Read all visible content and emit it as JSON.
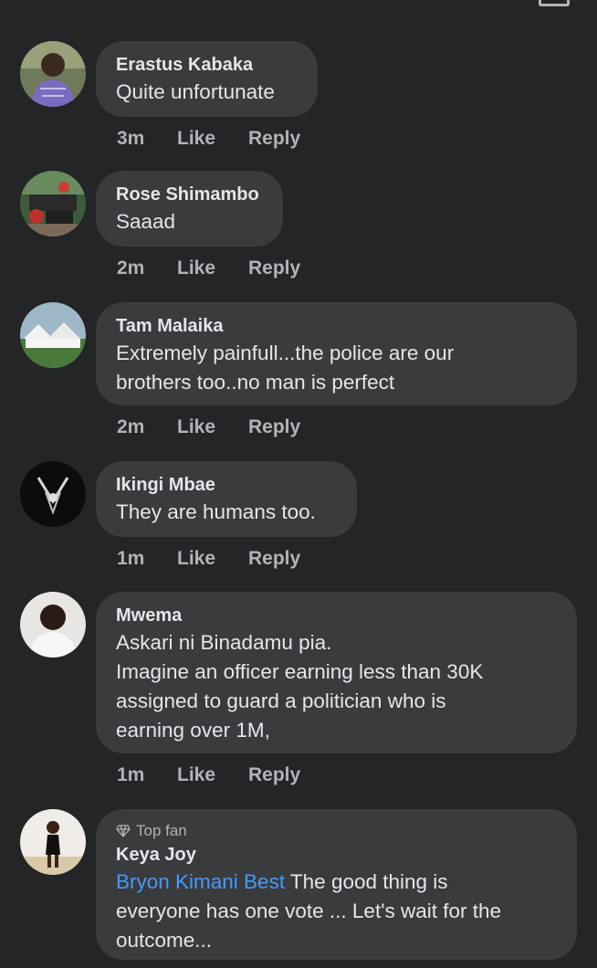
{
  "comments": [
    {
      "name": "Erastus Kabaka",
      "text": "Quite unfortunate",
      "time": "3m",
      "like": "Like",
      "reply": "Reply"
    },
    {
      "name": "Rose Shimambo",
      "text": "Saaad",
      "time": "2m",
      "like": "Like",
      "reply": "Reply"
    },
    {
      "name": "Tam Malaika",
      "text_lines": [
        "Extremely painfull...the police are our",
        "brothers too..no man is perfect"
      ],
      "time": "2m",
      "like": "Like",
      "reply": "Reply"
    },
    {
      "name": "Ikingi Mbae",
      "text": "They are humans too.",
      "time": "1m",
      "like": "Like",
      "reply": "Reply"
    },
    {
      "name": "Mwema",
      "text_lines": [
        "Askari ni Binadamu pia.",
        "Imagine an officer earning less than 30K",
        "assigned to guard a politician who is",
        "earning over 1M,"
      ],
      "time": "1m",
      "like": "Like",
      "reply": "Reply"
    },
    {
      "badge": "Top fan",
      "name": "Keya Joy",
      "mention": "Bryon Kimani Best",
      "text_first": " The good thing is",
      "text_lines": [
        "everyone has one vote ... Let's wait for the",
        "outcome..."
      ]
    }
  ],
  "colors": {
    "background": "#242527",
    "bubble": "#3a3b3c",
    "text": "#e4e6eb",
    "muted": "#b0b3b8",
    "link": "#4599ff"
  }
}
